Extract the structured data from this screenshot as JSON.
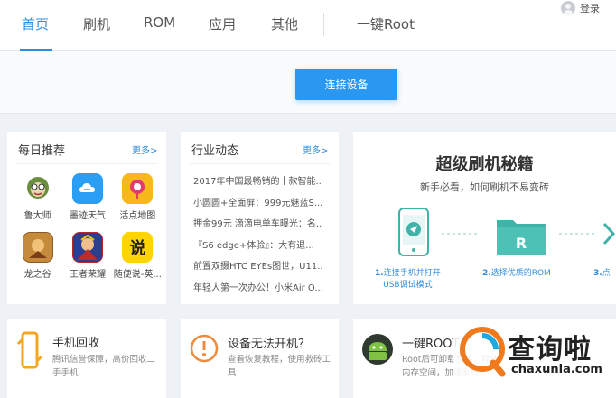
{
  "nav": {
    "items": [
      {
        "label": "首页",
        "active": true
      },
      {
        "label": "刷机"
      },
      {
        "label": "ROM"
      },
      {
        "label": "应用"
      },
      {
        "label": "其他"
      },
      {
        "label": "一键Root"
      }
    ],
    "login": "登录",
    "accent": "#2f8ddf"
  },
  "connect": {
    "button_label": "连接设备",
    "color": "#2a97f0"
  },
  "daily": {
    "title": "每日推荐",
    "more": "更多>",
    "apps": [
      {
        "label": "鲁大师",
        "icon": "ludashi-icon"
      },
      {
        "label": "墨迹天气",
        "icon": "moji-weather-icon"
      },
      {
        "label": "活点地图",
        "icon": "huodian-map-icon"
      },
      {
        "label": "龙之谷",
        "icon": "longzhigu-icon"
      },
      {
        "label": "王者荣耀",
        "icon": "wangzhe-icon"
      },
      {
        "label": "随便说-英...",
        "icon": "suibianshuo-icon"
      }
    ]
  },
  "industry": {
    "title": "行业动态",
    "more": "更多>",
    "news": [
      "2017年中国最畅销的十款智能...",
      "小圆圆+全面屏：999元魅蓝S...",
      "押金99元 滴滴电单车曝光：名...",
      "『S6 edge+体验』：大有退...",
      "前置双摄HTC EYEs图世，U11...",
      "年轻人第一次办公！小米Air O..."
    ]
  },
  "promo": {
    "title": "超级刷机秘籍",
    "subtitle": "新手必看，如何刷机不易变砖",
    "steps": [
      {
        "num": "1.",
        "text": "连接手机并打开",
        "sub": "USB调试模式"
      },
      {
        "num": "2.",
        "text": "选择优质的ROM"
      },
      {
        "num": "3.",
        "text": "点"
      }
    ],
    "folder_letter": "R"
  },
  "bottom": [
    {
      "title": "手机回收",
      "desc": "腾讯信誉保障，高价回收二手手机",
      "icon": "phone-recycle-icon"
    },
    {
      "title": "设备无法开机？",
      "desc": "查看恢复教程，使用救砖工具",
      "icon": "warning-icon"
    },
    {
      "title": "一键ROOT",
      "desc": "Root后可卸载预装，释放内存空间，加速系统",
      "icon": "root-android-icon"
    }
  ],
  "watermark": {
    "cn": "查询啦",
    "site": "chaxunla.com"
  }
}
